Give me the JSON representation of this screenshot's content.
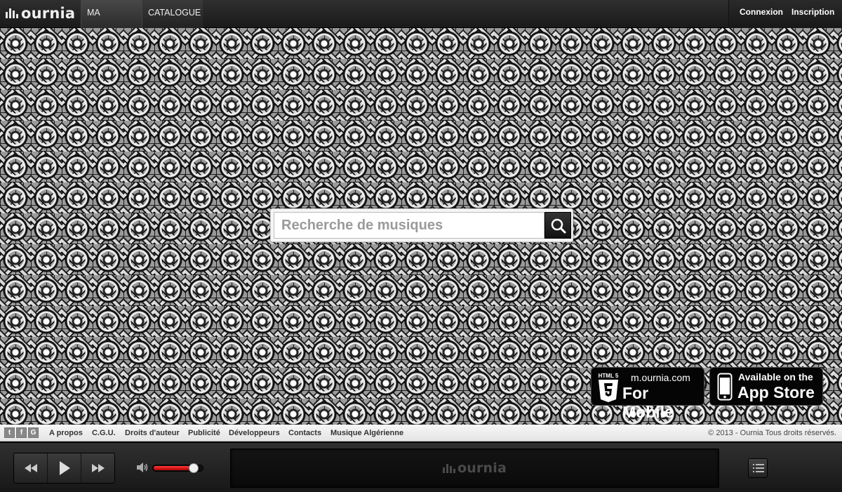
{
  "header": {
    "logo_text": "ournia",
    "nav": [
      "MA MUSIQUE",
      "CATALOGUE"
    ],
    "login": "Connexion",
    "signup": "Inscription"
  },
  "search": {
    "placeholder": "Recherche de musiques",
    "button_icon": "search-icon"
  },
  "badges": {
    "mobile": {
      "badge_text": "HTML 5",
      "line1": "m.ournia.com",
      "line2": "For Mobile"
    },
    "appstore": {
      "line1": "Available on the",
      "line2": "App Store"
    }
  },
  "footer": {
    "social": [
      "t",
      "f",
      "G"
    ],
    "links": [
      "A propos",
      "C.G.U.",
      "Droits d'auteur",
      "Publicité",
      "Développeurs",
      "Contacts",
      "Musique Algérienne"
    ],
    "copyright": "© 2013 - Ournia Tous droits réservés."
  },
  "player": {
    "logo_text": "ournia",
    "volume_level": 0.82,
    "buttons": [
      "rewind-icon",
      "play-icon",
      "fast-forward-icon"
    ],
    "playlist_icon": "list-icon"
  },
  "colors": {
    "accent": "#e01515",
    "dark": "#1a1a1a"
  }
}
